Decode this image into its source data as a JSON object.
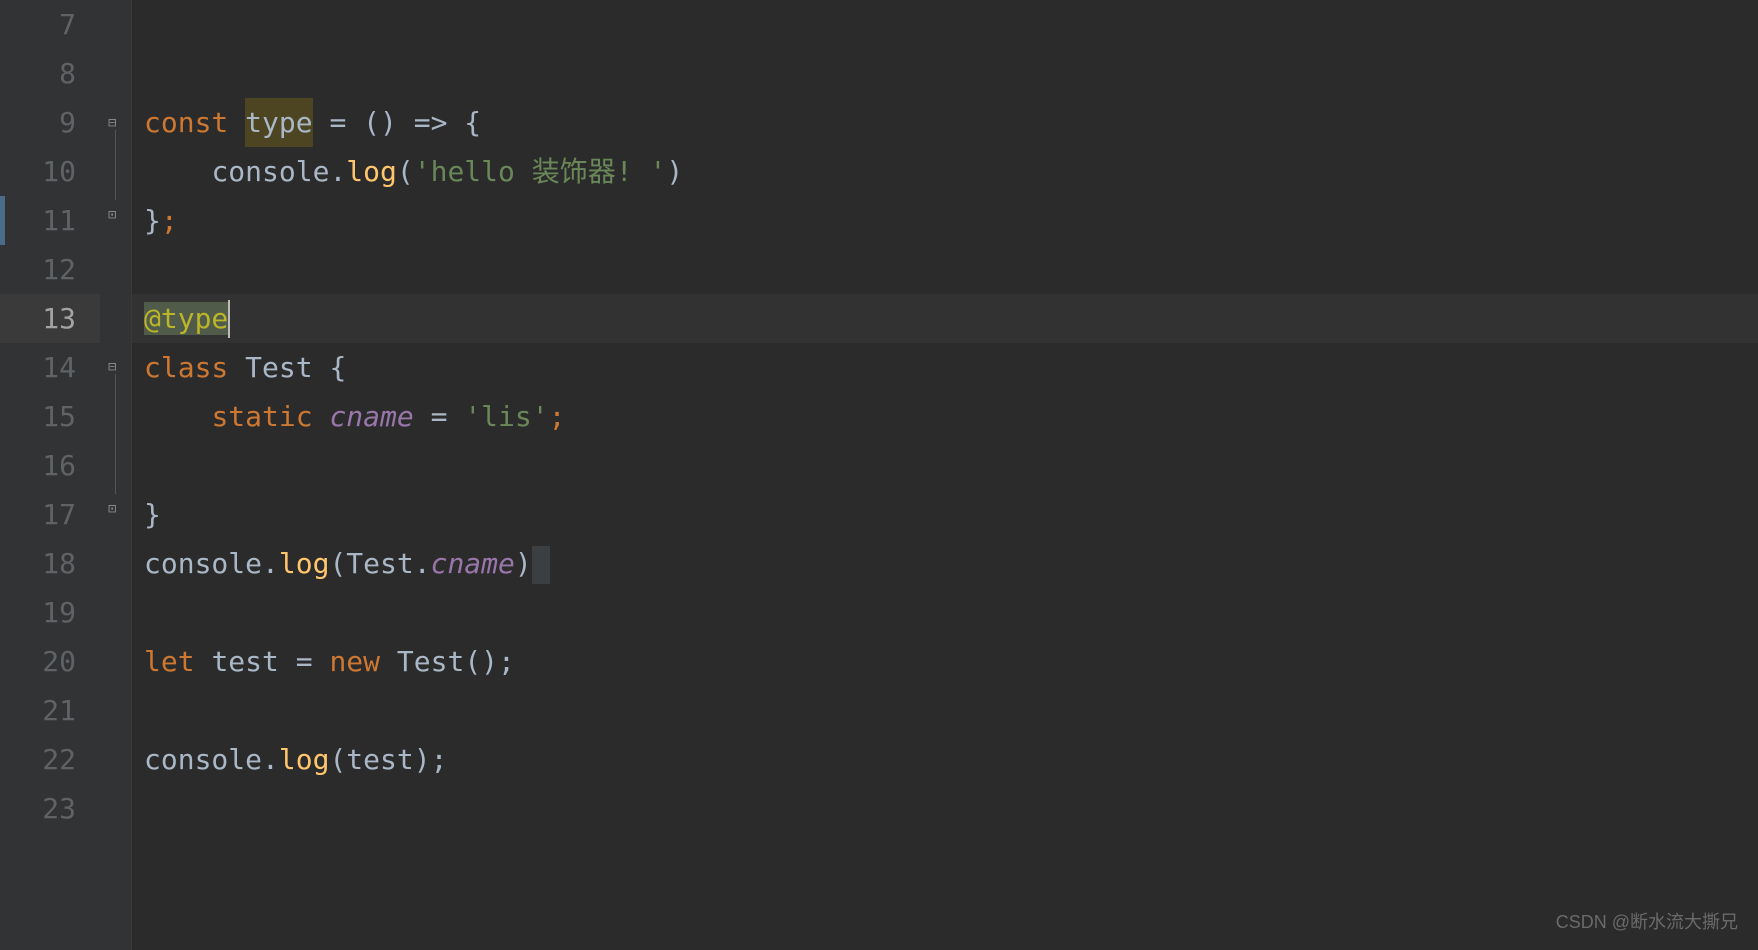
{
  "gutter": {
    "lines": [
      "7",
      "8",
      "9",
      "10",
      "11",
      "12",
      "13",
      "14",
      "15",
      "16",
      "17",
      "18",
      "19",
      "20",
      "21",
      "22",
      "23"
    ]
  },
  "code": {
    "l9": {
      "const": "const ",
      "type": "type",
      "eq": " = () => {"
    },
    "l10": {
      "indent": "    ",
      "console": "console.",
      "log": "log",
      "open": "(",
      "str": "'hello 装饰器! '",
      "close": ")"
    },
    "l11": {
      "brace": "}",
      "semi": ";"
    },
    "l13": {
      "at": "@",
      "type": "type"
    },
    "l14": {
      "class": "class ",
      "name": "Test {"
    },
    "l15": {
      "indent": "    ",
      "static": "static ",
      "cname": "cname",
      "eq": " = ",
      "str": "'lis'",
      "semi": ";"
    },
    "l17": {
      "brace": "}"
    },
    "l18": {
      "console": "console.",
      "log": "log",
      "open": "(",
      "test": "Test.",
      "cname": "cname",
      "close": ")"
    },
    "l20": {
      "let": "let ",
      "var": "test = ",
      "new": "new ",
      "call": "Test();"
    },
    "l22": {
      "console": "console.",
      "log": "log",
      "open": "(test);",
      "close": ""
    }
  },
  "watermark": "CSDN @断水流大撕兄"
}
